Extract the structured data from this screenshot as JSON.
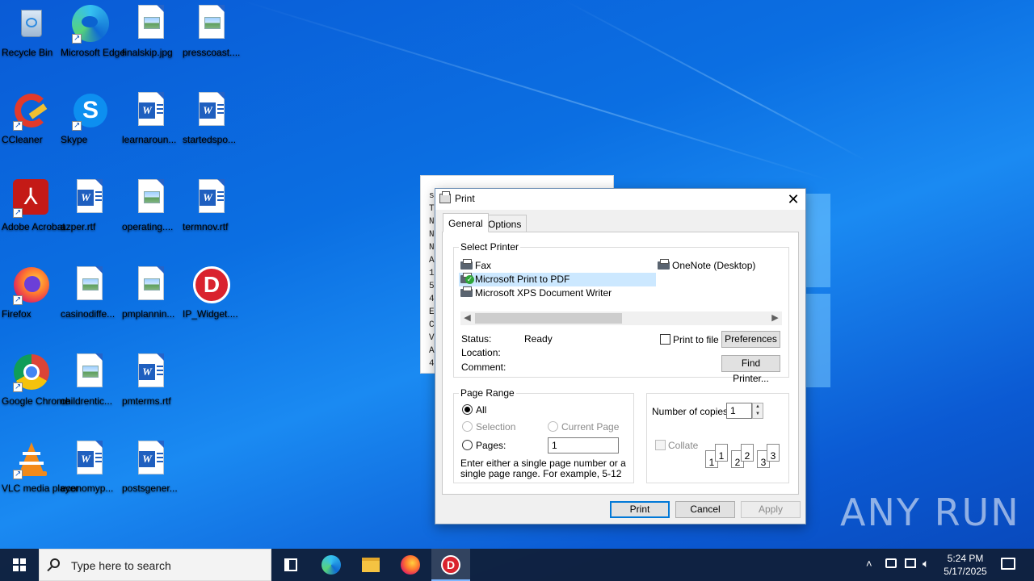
{
  "desktop": {
    "icons": [
      {
        "label": "Recycle Bin",
        "icon": "recycle-bin-icon"
      },
      {
        "label": "Microsoft Edge",
        "icon": "edge-icon"
      },
      {
        "label": "finalskip.jpg",
        "icon": "image-file-icon"
      },
      {
        "label": "presscoast....",
        "icon": "image-file-icon"
      },
      {
        "label": "CCleaner",
        "icon": "ccleaner-icon"
      },
      {
        "label": "Skype",
        "icon": "skype-icon"
      },
      {
        "label": "learnaroun...",
        "icon": "word-doc-icon"
      },
      {
        "label": "startedspo...",
        "icon": "word-doc-icon"
      },
      {
        "label": "Adobe Acrobat",
        "icon": "acrobat-icon"
      },
      {
        "label": "azper.rtf",
        "icon": "word-doc-icon"
      },
      {
        "label": "operating....",
        "icon": "image-file-icon"
      },
      {
        "label": "termnov.rtf",
        "icon": "word-doc-icon"
      },
      {
        "label": "Firefox",
        "icon": "firefox-icon"
      },
      {
        "label": "casinodiffe...",
        "icon": "image-file-icon"
      },
      {
        "label": "pmplannin...",
        "icon": "image-file-icon"
      },
      {
        "label": "IP_Widget....",
        "icon": "ip-widget-icon"
      },
      {
        "label": "Google Chrome",
        "icon": "chrome-icon"
      },
      {
        "label": "childrentic...",
        "icon": "image-file-icon"
      },
      {
        "label": "pmterms.rtf",
        "icon": "word-doc-icon"
      },
      {
        "label": "VLC media player",
        "icon": "vlc-icon"
      },
      {
        "label": "economyp...",
        "icon": "word-doc-icon"
      },
      {
        "label": "postsgener...",
        "icon": "word-doc-icon"
      }
    ]
  },
  "bg_window": {
    "lines": [
      "s",
      "T",
      "N",
      "N",
      "N",
      "A",
      "1",
      "5",
      "4",
      "E",
      "C",
      "V",
      "A",
      "4"
    ]
  },
  "print_dialog": {
    "title": "Print",
    "close_glyph": "✕",
    "tabs": [
      "General",
      "Options"
    ],
    "select_printer": {
      "title": "Select Printer",
      "printers": [
        "Fax",
        "Microsoft Print to PDF",
        "Microsoft XPS Document Writer",
        "OneNote (Desktop)"
      ],
      "selected": "Microsoft Print to PDF",
      "status_label": "Status:",
      "status_value": "Ready",
      "location_label": "Location:",
      "comment_label": "Comment:",
      "print_to_file": "Print to file",
      "preferences": "Preferences",
      "find_printer": "Find Printer..."
    },
    "page_range": {
      "title": "Page Range",
      "all": "All",
      "selection": "Selection",
      "current_page": "Current Page",
      "pages": "Pages:",
      "pages_value": "1",
      "hint": "Enter either a single page number or a single page range.  For example, 5-12"
    },
    "copies": {
      "label": "Number of copies:",
      "value": "1",
      "collate": "Collate",
      "collate_pages": [
        "1",
        "1",
        "2",
        "2",
        "3",
        "3"
      ]
    },
    "buttons": {
      "print": "Print",
      "cancel": "Cancel",
      "apply": "Apply"
    }
  },
  "taskbar": {
    "search_placeholder": "Type here to search",
    "clock_time": "5:24 PM",
    "clock_date": "5/17/2025",
    "pinned": [
      "task-view-icon",
      "edge-icon",
      "file-explorer-icon",
      "firefox-icon",
      "ip-widget-icon"
    ]
  },
  "watermark": "ANY RUN"
}
